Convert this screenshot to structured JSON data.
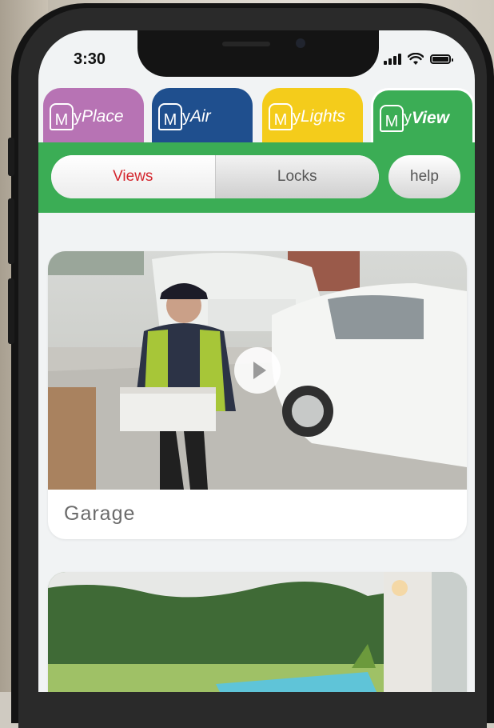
{
  "status_bar": {
    "time": "3:30"
  },
  "tabs": [
    {
      "prefix": "M",
      "y": "y",
      "suffix": "Place",
      "color": "#b773b4"
    },
    {
      "prefix": "M",
      "y": "y",
      "suffix": "Air",
      "color": "#1f4f8e"
    },
    {
      "prefix": "M",
      "y": "y",
      "suffix": "Lights",
      "color": "#f4cc1b"
    },
    {
      "prefix": "M",
      "y": "y",
      "suffix": "View",
      "color": "#3bad55",
      "active": true
    }
  ],
  "segmented": {
    "views_label": "Views",
    "locks_label": "Locks",
    "help_label": "help",
    "selected": "Views"
  },
  "cameras": [
    {
      "label": "Garage",
      "icon": "play-icon"
    },
    {
      "label": "",
      "icon": "play-icon"
    }
  ],
  "colors": {
    "accent_green": "#3bad55",
    "selected_text": "#d4272f"
  }
}
